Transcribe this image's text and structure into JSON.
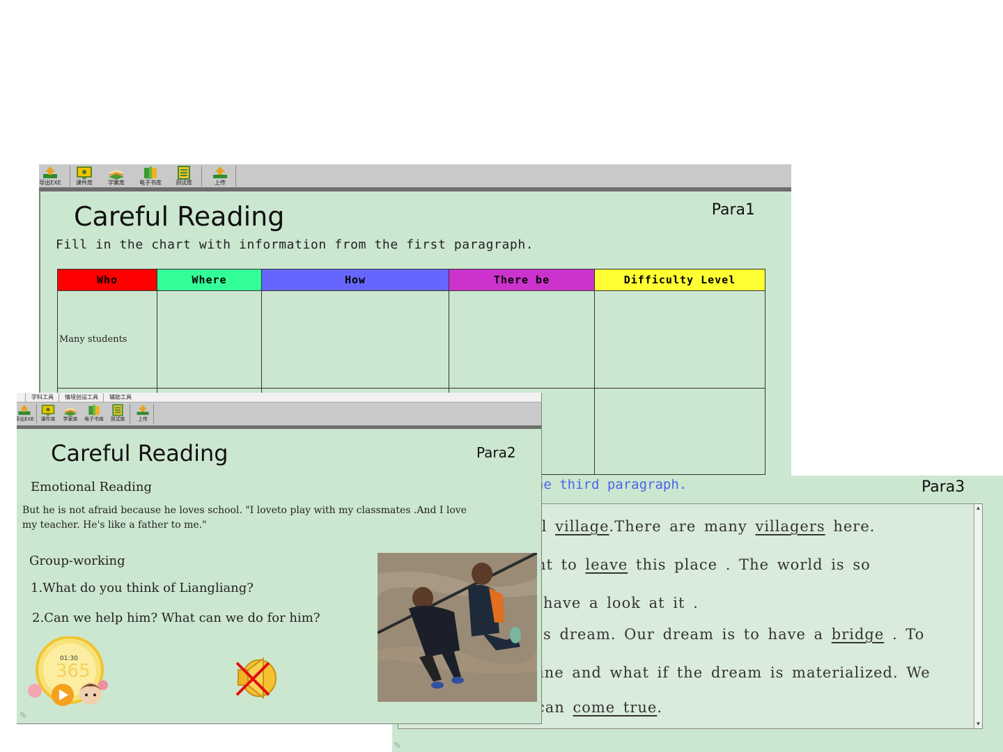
{
  "toolbar_main": {
    "items": [
      {
        "label": "导出EXE",
        "icon": "export-exe-icon"
      },
      {
        "label": "课件库",
        "icon": "courseware-library-icon"
      },
      {
        "label": "学案库",
        "icon": "study-plan-library-icon"
      },
      {
        "label": "电子书库",
        "icon": "ebook-library-icon"
      },
      {
        "label": "测试库",
        "icon": "test-library-icon"
      },
      {
        "label": "上传",
        "icon": "upload-icon"
      }
    ]
  },
  "window_para1": {
    "title": "Careful Reading",
    "para": "Para1",
    "instruction": "Fill in the chart with information from the first paragraph.",
    "table": {
      "headers": [
        "Who",
        "Where",
        "How",
        "There be",
        "Difficulty Level"
      ],
      "header_colors": [
        "#ff0000",
        "#33ff99",
        "#6666ff",
        "#cc33cc",
        "#ffff33"
      ],
      "rows": [
        [
          "Many students",
          "",
          "",
          "",
          ""
        ],
        [
          "",
          "",
          "",
          "",
          ""
        ]
      ]
    }
  },
  "window_para3": {
    "instruction_visible": "nks according to the third paragraph.",
    "para": "Para3",
    "lines": [
      {
        "pre": "ll ",
        "u1": "village",
        "mid": ".There are many ",
        "u2": "villagers",
        "post": " here."
      },
      {
        "pre": "nt to ",
        "u1": "leave",
        "mid": " this place . The world is so",
        "u2": "",
        "post": ""
      },
      {
        "pre": "have a look at it .",
        "u1": "",
        "mid": "",
        "u2": "",
        "post": ""
      },
      {
        "pre": "s dream. Our dream  is to have a ",
        "u1": "bridge",
        "mid": " . To",
        "u2": "",
        "post": ""
      },
      {
        "pre": "ine and what if the dream is materialized. We",
        "u1": "",
        "mid": "",
        "u2": "",
        "post": ""
      },
      {
        "pre": " can ",
        "u1": "come true",
        "mid": ".",
        "u2": "",
        "post": ""
      }
    ]
  },
  "window_para2": {
    "tabs": [
      "学科工具",
      "情境创设工具",
      "辅助工具"
    ],
    "title": "Careful Reading",
    "para": "Para2",
    "emotional_heading": "Emotional Reading",
    "quote": "But he is not afraid because he loves school. \"I loveto play with my classmates .And I love my teacher. He's like a father to me.\"",
    "group_heading": "Group-working",
    "q1": "1.What do you think of Liangliang?",
    "q2": "2.Can we help him? What can we do for him?",
    "timer_time": "01:30",
    "timer_bg_digits": "365",
    "sound_icon": "speaker-muted-icon"
  }
}
